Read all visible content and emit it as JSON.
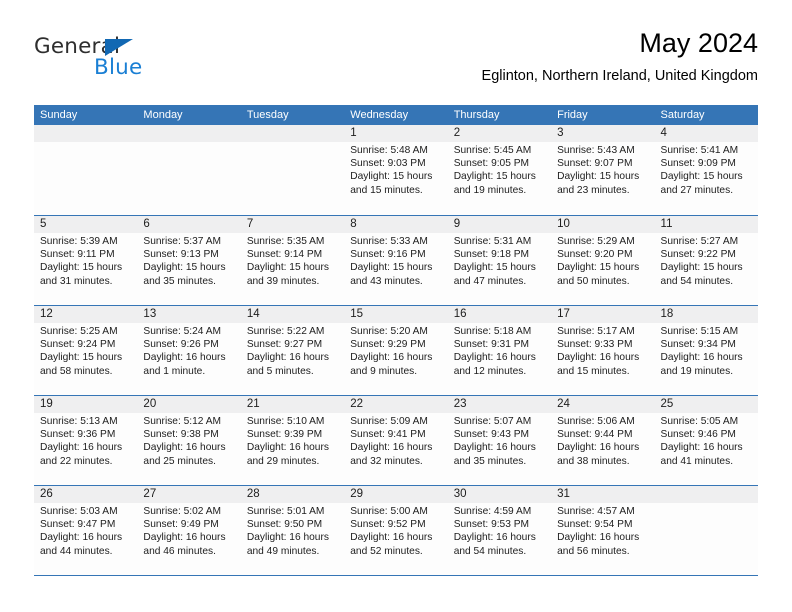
{
  "brand": {
    "name_part1": "General",
    "name_part2": "Blue",
    "triangle_color": "#1268b3",
    "blue_color": "#1a7fd4"
  },
  "header": {
    "title": "May 2024",
    "subtitle": "Eglinton, Northern Ireland, United Kingdom"
  },
  "theme": {
    "header_bg": "#3575b6",
    "header_text": "#ffffff",
    "daynum_bg": "#efeff0",
    "cell_bg": "#fdfdfd",
    "rule_color": "#3575b6"
  },
  "calendar": {
    "weekdays": [
      "Sunday",
      "Monday",
      "Tuesday",
      "Wednesday",
      "Thursday",
      "Friday",
      "Saturday"
    ],
    "weeks": [
      [
        {
          "day": "",
          "lines": []
        },
        {
          "day": "",
          "lines": []
        },
        {
          "day": "",
          "lines": []
        },
        {
          "day": "1",
          "lines": [
            "Sunrise: 5:48 AM",
            "Sunset: 9:03 PM",
            "Daylight: 15 hours",
            "and 15 minutes."
          ]
        },
        {
          "day": "2",
          "lines": [
            "Sunrise: 5:45 AM",
            "Sunset: 9:05 PM",
            "Daylight: 15 hours",
            "and 19 minutes."
          ]
        },
        {
          "day": "3",
          "lines": [
            "Sunrise: 5:43 AM",
            "Sunset: 9:07 PM",
            "Daylight: 15 hours",
            "and 23 minutes."
          ]
        },
        {
          "day": "4",
          "lines": [
            "Sunrise: 5:41 AM",
            "Sunset: 9:09 PM",
            "Daylight: 15 hours",
            "and 27 minutes."
          ]
        }
      ],
      [
        {
          "day": "5",
          "lines": [
            "Sunrise: 5:39 AM",
            "Sunset: 9:11 PM",
            "Daylight: 15 hours",
            "and 31 minutes."
          ]
        },
        {
          "day": "6",
          "lines": [
            "Sunrise: 5:37 AM",
            "Sunset: 9:13 PM",
            "Daylight: 15 hours",
            "and 35 minutes."
          ]
        },
        {
          "day": "7",
          "lines": [
            "Sunrise: 5:35 AM",
            "Sunset: 9:14 PM",
            "Daylight: 15 hours",
            "and 39 minutes."
          ]
        },
        {
          "day": "8",
          "lines": [
            "Sunrise: 5:33 AM",
            "Sunset: 9:16 PM",
            "Daylight: 15 hours",
            "and 43 minutes."
          ]
        },
        {
          "day": "9",
          "lines": [
            "Sunrise: 5:31 AM",
            "Sunset: 9:18 PM",
            "Daylight: 15 hours",
            "and 47 minutes."
          ]
        },
        {
          "day": "10",
          "lines": [
            "Sunrise: 5:29 AM",
            "Sunset: 9:20 PM",
            "Daylight: 15 hours",
            "and 50 minutes."
          ]
        },
        {
          "day": "11",
          "lines": [
            "Sunrise: 5:27 AM",
            "Sunset: 9:22 PM",
            "Daylight: 15 hours",
            "and 54 minutes."
          ]
        }
      ],
      [
        {
          "day": "12",
          "lines": [
            "Sunrise: 5:25 AM",
            "Sunset: 9:24 PM",
            "Daylight: 15 hours",
            "and 58 minutes."
          ]
        },
        {
          "day": "13",
          "lines": [
            "Sunrise: 5:24 AM",
            "Sunset: 9:26 PM",
            "Daylight: 16 hours",
            "and 1 minute."
          ]
        },
        {
          "day": "14",
          "lines": [
            "Sunrise: 5:22 AM",
            "Sunset: 9:27 PM",
            "Daylight: 16 hours",
            "and 5 minutes."
          ]
        },
        {
          "day": "15",
          "lines": [
            "Sunrise: 5:20 AM",
            "Sunset: 9:29 PM",
            "Daylight: 16 hours",
            "and 9 minutes."
          ]
        },
        {
          "day": "16",
          "lines": [
            "Sunrise: 5:18 AM",
            "Sunset: 9:31 PM",
            "Daylight: 16 hours",
            "and 12 minutes."
          ]
        },
        {
          "day": "17",
          "lines": [
            "Sunrise: 5:17 AM",
            "Sunset: 9:33 PM",
            "Daylight: 16 hours",
            "and 15 minutes."
          ]
        },
        {
          "day": "18",
          "lines": [
            "Sunrise: 5:15 AM",
            "Sunset: 9:34 PM",
            "Daylight: 16 hours",
            "and 19 minutes."
          ]
        }
      ],
      [
        {
          "day": "19",
          "lines": [
            "Sunrise: 5:13 AM",
            "Sunset: 9:36 PM",
            "Daylight: 16 hours",
            "and 22 minutes."
          ]
        },
        {
          "day": "20",
          "lines": [
            "Sunrise: 5:12 AM",
            "Sunset: 9:38 PM",
            "Daylight: 16 hours",
            "and 25 minutes."
          ]
        },
        {
          "day": "21",
          "lines": [
            "Sunrise: 5:10 AM",
            "Sunset: 9:39 PM",
            "Daylight: 16 hours",
            "and 29 minutes."
          ]
        },
        {
          "day": "22",
          "lines": [
            "Sunrise: 5:09 AM",
            "Sunset: 9:41 PM",
            "Daylight: 16 hours",
            "and 32 minutes."
          ]
        },
        {
          "day": "23",
          "lines": [
            "Sunrise: 5:07 AM",
            "Sunset: 9:43 PM",
            "Daylight: 16 hours",
            "and 35 minutes."
          ]
        },
        {
          "day": "24",
          "lines": [
            "Sunrise: 5:06 AM",
            "Sunset: 9:44 PM",
            "Daylight: 16 hours",
            "and 38 minutes."
          ]
        },
        {
          "day": "25",
          "lines": [
            "Sunrise: 5:05 AM",
            "Sunset: 9:46 PM",
            "Daylight: 16 hours",
            "and 41 minutes."
          ]
        }
      ],
      [
        {
          "day": "26",
          "lines": [
            "Sunrise: 5:03 AM",
            "Sunset: 9:47 PM",
            "Daylight: 16 hours",
            "and 44 minutes."
          ]
        },
        {
          "day": "27",
          "lines": [
            "Sunrise: 5:02 AM",
            "Sunset: 9:49 PM",
            "Daylight: 16 hours",
            "and 46 minutes."
          ]
        },
        {
          "day": "28",
          "lines": [
            "Sunrise: 5:01 AM",
            "Sunset: 9:50 PM",
            "Daylight: 16 hours",
            "and 49 minutes."
          ]
        },
        {
          "day": "29",
          "lines": [
            "Sunrise: 5:00 AM",
            "Sunset: 9:52 PM",
            "Daylight: 16 hours",
            "and 52 minutes."
          ]
        },
        {
          "day": "30",
          "lines": [
            "Sunrise: 4:59 AM",
            "Sunset: 9:53 PM",
            "Daylight: 16 hours",
            "and 54 minutes."
          ]
        },
        {
          "day": "31",
          "lines": [
            "Sunrise: 4:57 AM",
            "Sunset: 9:54 PM",
            "Daylight: 16 hours",
            "and 56 minutes."
          ]
        },
        {
          "day": "",
          "lines": []
        }
      ]
    ]
  }
}
